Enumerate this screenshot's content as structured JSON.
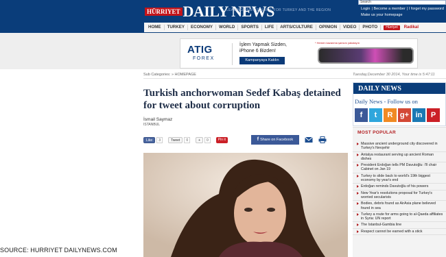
{
  "header": {
    "logo_prefix": "HÜRRIYET",
    "logo_main": "DAILY NEWS",
    "tagline": "LEADING NEWS SOURCE FOR TURKEY AND THE REGION",
    "search_label": "Search",
    "login_link": "Login",
    "become_member_link": "Become a member",
    "forgot_password_link": "I forget my password",
    "homepage_link": "Make us your homepage"
  },
  "nav": {
    "items": [
      "HOME",
      "TURKEY",
      "ECONOMY",
      "WORLD",
      "SPORTS",
      "LIFE",
      "ARTS/CULTURE",
      "OPINION",
      "VIDEO",
      "PHOTO"
    ],
    "badge": "Hürriyet",
    "radikal": "Radikal"
  },
  "ad": {
    "brand": "ATIG",
    "brand_sub": "FOREX",
    "line1": "İşlem Yapmak Sizden,",
    "line2": "iPhone 6 Bizden!",
    "cta": "Kampanyaya Katılın",
    "note": "* Hemen kazanma şansını yakalayın"
  },
  "breadcrumb": {
    "text": "Sub Categories: » HOMEPAGE",
    "date": "Tuesday,December 30 2014, Your time is 5:47:11"
  },
  "article": {
    "headline": "Turkish anchorwoman Sedef Kabaş detained for tweet about corruption",
    "author": "İsmail Saymaz",
    "location": "ISTANBUL",
    "like_label": "Like",
    "like_count": "3",
    "tweet_label": "Tweet",
    "tweet_count": "0",
    "gplus_label": "+",
    "gplus_count": "0",
    "pin_label": "Pin it",
    "share_label": "Share on Facebook"
  },
  "sidebar": {
    "follow_logo": "DAILY NEWS",
    "follow_text": "Daily News - Follow us on",
    "social": [
      {
        "name": "facebook",
        "glyph": "f",
        "color": "#3b5998"
      },
      {
        "name": "twitter",
        "glyph": "t",
        "color": "#2fa6dc"
      },
      {
        "name": "rss",
        "glyph": "R",
        "color": "#f08a24"
      },
      {
        "name": "googleplus",
        "glyph": "g+",
        "color": "#d34836"
      },
      {
        "name": "linkedin",
        "glyph": "in",
        "color": "#1b79b4"
      },
      {
        "name": "pinterest",
        "glyph": "P",
        "color": "#cb2027"
      }
    ],
    "most_popular_title": "MOST POPULAR",
    "most_popular": [
      "Massive ancient underground city discovered in Turkey's Nevşehir",
      "Antalya restaurant serving up ancient Roman dishes",
      "President Erdoğan tells PM Davutoğlu: I'll chair Cabinet on Jan 19",
      "Turkey to slide back to world's 19th biggest economy by year's end",
      "Erdoğan reminds Davutoğlu of his powers",
      "New Year's resolutions proposal for Turkey's worried secularists",
      "Bodies, debris found as AirAsia plane believed found in sea",
      "Turkey a route for arms going to al-Qaeda affiliates in Syria: UN report",
      "The Istanbul-Gambia line",
      "Respect cannot be earned with a stick"
    ]
  },
  "source_caption": "SOURCE: HURRIYET DAILYNEWS.COM"
}
